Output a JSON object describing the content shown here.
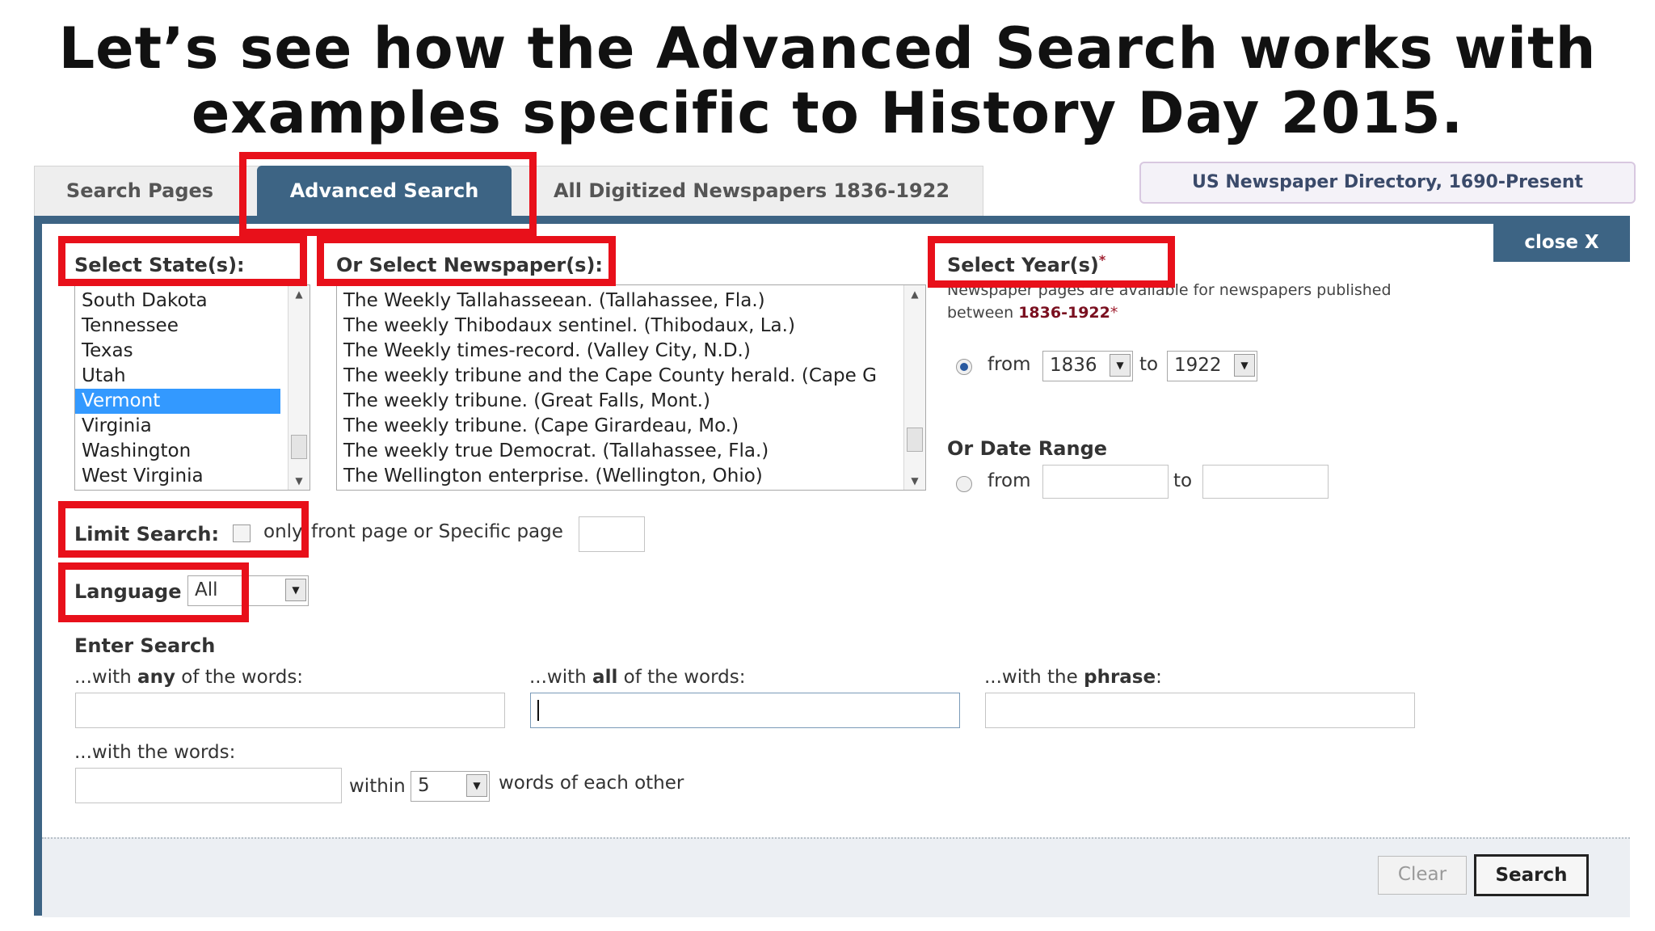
{
  "headline": {
    "line1": "Let’s see how the Advanced Search works with",
    "line2": "examples specific to History Day 2015."
  },
  "tabs": [
    {
      "label": "Search Pages"
    },
    {
      "label": "Advanced Search"
    },
    {
      "label": "All Digitized Newspapers 1836-1922"
    }
  ],
  "directory_button": "US Newspaper Directory, 1690-Present",
  "close_label": "close X",
  "states": {
    "label": "Select State(s):",
    "items": [
      "South Dakota",
      "Tennessee",
      "Texas",
      "Utah",
      "Vermont",
      "Virginia",
      "Washington",
      "West Virginia"
    ],
    "selected": "Vermont"
  },
  "newspapers": {
    "label": "Or Select Newspaper(s):",
    "items": [
      "The Weekly Tallahasseean. (Tallahassee, Fla.)",
      "The weekly Thibodaux sentinel. (Thibodaux, La.)",
      "The Weekly times-record. (Valley City, N.D.)",
      "The weekly tribune and the Cape County herald. (Cape G",
      "The weekly tribune. (Great Falls, Mont.)",
      "The weekly tribune. (Cape Girardeau, Mo.)",
      "The weekly true Democrat. (Tallahassee, Fla.)",
      "The Wellington enterprise. (Wellington, Ohio)"
    ]
  },
  "years": {
    "label": "Select Year(s)",
    "asterisk": "*",
    "note_line1": "Newspaper pages are available for newspapers published",
    "note_line2_prefix": "between ",
    "note_range": "1836-1922",
    "from_label": "from",
    "to_label": "to",
    "from_value": "1836",
    "to_value": "1922"
  },
  "date_range": {
    "label": "Or Date Range",
    "from_label": "from",
    "to_label": "to"
  },
  "limit": {
    "label": "Limit Search:",
    "only": "only",
    "rest": "front page or Specific page"
  },
  "language": {
    "label": "Language",
    "value": "All"
  },
  "enter_search": {
    "label": "Enter Search",
    "any_prefix": "...with ",
    "any_bold": "any",
    "any_suffix": " of the words:",
    "all_prefix": "...with ",
    "all_bold": "all",
    "all_suffix": " of the words:",
    "phrase_prefix": "...with the ",
    "phrase_bold": "phrase",
    "phrase_suffix": ":",
    "words_label": "...with the words:",
    "within_label": "within",
    "within_value": "5",
    "words_each_other": "words of each other"
  },
  "buttons": {
    "clear": "Clear",
    "search": "Search"
  },
  "colors": {
    "accent": "#3d6484",
    "highlight": "#e8101a",
    "selection": "#3399ff"
  }
}
